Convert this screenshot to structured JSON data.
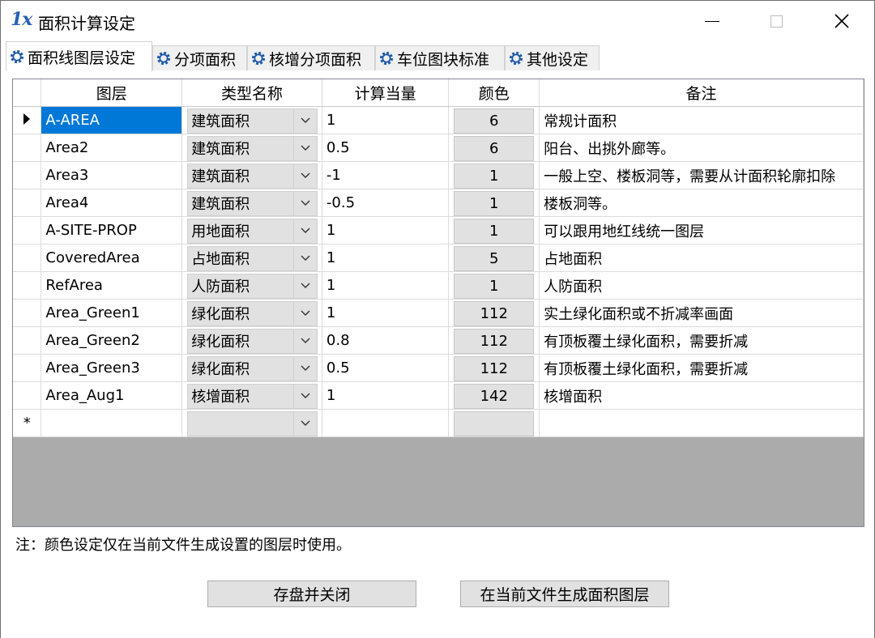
{
  "window": {
    "logo": "1x",
    "title": "面积计算设定"
  },
  "tabs": [
    {
      "label": "面积线图层设定",
      "active": true
    },
    {
      "label": "分项面积",
      "active": false
    },
    {
      "label": "核增分项面积",
      "active": false
    },
    {
      "label": "车位图块标准",
      "active": false
    },
    {
      "label": "其他设定",
      "active": false
    }
  ],
  "grid": {
    "columns": [
      "图层",
      "类型名称",
      "计算当量",
      "颜色",
      "备注"
    ],
    "rows": [
      {
        "layer": "A-AREA",
        "type": "建筑面积",
        "factor": "1",
        "color": "6",
        "remark": "常规计面积"
      },
      {
        "layer": "Area2",
        "type": "建筑面积",
        "factor": "0.5",
        "color": "6",
        "remark": "阳台、出挑外廊等。"
      },
      {
        "layer": "Area3",
        "type": "建筑面积",
        "factor": "-1",
        "color": "1",
        "remark": "一般上空、楼板洞等，需要从计面积轮廓扣除"
      },
      {
        "layer": "Area4",
        "type": "建筑面积",
        "factor": "-0.5",
        "color": "1",
        "remark": "楼板洞等。"
      },
      {
        "layer": "A-SITE-PROP",
        "type": "用地面积",
        "factor": "1",
        "color": "1",
        "remark": "可以跟用地红线统一图层"
      },
      {
        "layer": "CoveredArea",
        "type": "占地面积",
        "factor": "1",
        "color": "5",
        "remark": "占地面积"
      },
      {
        "layer": "RefArea",
        "type": "人防面积",
        "factor": "1",
        "color": "1",
        "remark": "人防面积"
      },
      {
        "layer": "Area_Green1",
        "type": "绿化面积",
        "factor": "1",
        "color": "112",
        "remark": "实土绿化面积或不折减率画面"
      },
      {
        "layer": "Area_Green2",
        "type": "绿化面积",
        "factor": "0.8",
        "color": "112",
        "remark": "有顶板覆土绿化面积，需要折减"
      },
      {
        "layer": "Area_Green3",
        "type": "绿化面积",
        "factor": "0.5",
        "color": "112",
        "remark": "有顶板覆土绿化面积，需要折减"
      },
      {
        "layer": "Area_Aug1",
        "type": "核增面积",
        "factor": "1",
        "color": "142",
        "remark": "核增面积"
      }
    ],
    "new_row_marker": "*",
    "selection_color": "#0078d7"
  },
  "footer": {
    "note": "注：颜色设定仅在当前文件生成设置的图层时使用。",
    "save_label": "存盘并关闭",
    "generate_label": "在当前文件生成面积图层"
  }
}
